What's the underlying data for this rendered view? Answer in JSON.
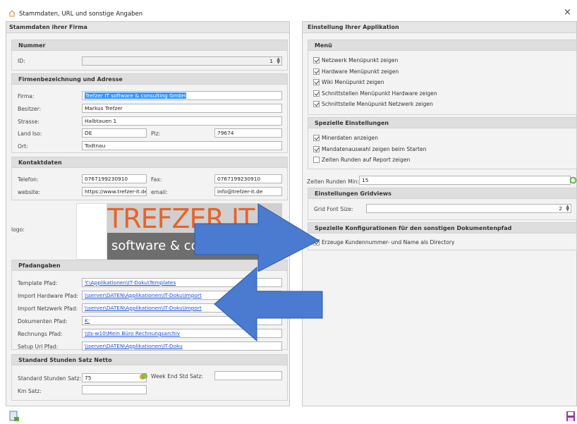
{
  "window": {
    "title": "Stammdaten, URL und sonstige Angaben",
    "close": "×"
  },
  "left": {
    "header": "Stammdaten ihrer Firma",
    "nummer": {
      "header": "Nummer",
      "id_label": "ID:",
      "id_value": "1"
    },
    "firma": {
      "header": "Firmenbezeichnung und Adresse",
      "firma_label": "Firma:",
      "firma_value": "Trefzer IT software & consulting GmbH",
      "besitzer_label": "Besitzer:",
      "besitzer_value": "Markus Trefzer",
      "strasse_label": "Strasse:",
      "strasse_value": "Halbtauen 1",
      "land_label": "Land Iso:",
      "land_value": "DE",
      "plz_label": "Plz:",
      "plz_value": "79674",
      "ort_label": "Ort:",
      "ort_value": "Todtnau"
    },
    "kontakt": {
      "header": "Kontaktdaten",
      "telefon_label": "Telefon:",
      "telefon_value": "0767199230910",
      "fax_label": "Fax:",
      "fax_value": "0767199230910",
      "website_label": "website:",
      "website_value": "https://www.trefzer-it.de,",
      "email_label": "email:",
      "email_value": "info@trefzer-it.de"
    },
    "logo": {
      "label": "logo:",
      "text_top": "TREFZER IT",
      "text_bottom": "software & consulting"
    },
    "pfad": {
      "header": "Pfadangaben",
      "rows": [
        {
          "label": "Template Pfad:",
          "value": "Y:\\Applikationen\\IT-Doku\\Templates"
        },
        {
          "label": "Import Hardware Pfad:",
          "value": "\\\\server\\DATEN\\Applikationen\\IT-Doku\\Import"
        },
        {
          "label": "Import Netzwerk Pfad:",
          "value": "\\\\server\\DATEN\\Applikationen\\IT-Doku\\Import"
        },
        {
          "label": "Dokumenten Pfad:",
          "value": "K:"
        },
        {
          "label": "Rechnungs Pfad:",
          "value": "\\\\ts-w10\\Mein Büro Rechnungsarchiv"
        },
        {
          "label": "Setup Url Pfad:",
          "value": "\\\\server\\DATEN\\Applikationen\\IT-Doku"
        }
      ]
    },
    "stunden": {
      "header": "Standard Stunden Satz Netto",
      "satz_label": "Standard Stunden Satz:",
      "satz_value": "75",
      "weekend_label": "Week End Std Satz:",
      "weekend_value": "",
      "km_label": "Km Satz:",
      "km_value": ""
    }
  },
  "right": {
    "header": "Einstellung Ihrer Applikation",
    "menu": {
      "header": "Menü",
      "items": [
        {
          "label": "Netzwerk Menüpunkt zeigen",
          "checked": true
        },
        {
          "label": "Hardware Menüpunkt zeigen",
          "checked": true
        },
        {
          "label": "Wiki Menüpunkt zeigen",
          "checked": true
        },
        {
          "label": "Schnittstellen Menüpunkt Hardware zeigen",
          "checked": true
        },
        {
          "label": "Schnittstelle Menüpunkt Netzwerk zeigen",
          "checked": true
        }
      ]
    },
    "speziell": {
      "header": "Spezielle Einstellungen",
      "items": [
        {
          "label": "Minerdaten anzeigen",
          "checked": true
        },
        {
          "label": "Mandatenauswahl zeigen beim Starten",
          "checked": true
        },
        {
          "label": "Zeiten Runden auf Report zeigen",
          "checked": false
        }
      ]
    },
    "zeiten": {
      "label": "Zeiten Runden Min:",
      "value": "15"
    },
    "grid": {
      "header": "Einstellungen Gridviews",
      "font_label": "Grid Font Size:",
      "font_value": "2"
    },
    "doku": {
      "header": "Spezielle Konfigurationen für den sonstigen Dokumentenpfad",
      "items": [
        {
          "label": "Erzeuge Kundennummer- und Name als Directory",
          "checked": true
        }
      ]
    }
  },
  "colors": {
    "arrow": "#4a7bd0",
    "accent": "#3296ff",
    "logo_orange": "#e8632b"
  }
}
